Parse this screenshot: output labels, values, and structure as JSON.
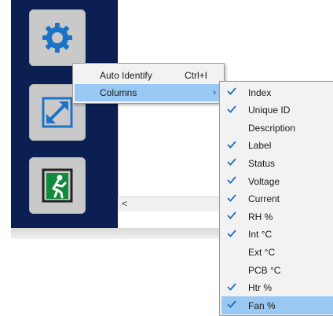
{
  "context_menu": {
    "items": [
      {
        "label": "Auto Identify",
        "shortcut": "Ctrl+I"
      },
      {
        "label": "Columns",
        "submenu_arrow": "›"
      }
    ]
  },
  "columns_submenu": {
    "items": [
      {
        "label": "Index",
        "checked": true
      },
      {
        "label": "Unique ID",
        "checked": true
      },
      {
        "label": "Description",
        "checked": false
      },
      {
        "label": "Label",
        "checked": true
      },
      {
        "label": "Status",
        "checked": true
      },
      {
        "label": "Voltage",
        "checked": true
      },
      {
        "label": "Current",
        "checked": true
      },
      {
        "label": "RH %",
        "checked": true
      },
      {
        "label": "Int °C",
        "checked": true
      },
      {
        "label": "Ext °C",
        "checked": false
      },
      {
        "label": "PCB °C",
        "checked": false
      },
      {
        "label": "Htr %",
        "checked": true
      },
      {
        "label": "Fan %",
        "checked": true
      }
    ],
    "highlighted_index": 12
  },
  "scrollbar": {
    "left_arrow": "<"
  },
  "colors": {
    "panel": "#0b1f52",
    "highlight": "#99c8f3",
    "check": "#1f6fbf",
    "icon_blue": "#1b73c8"
  },
  "icons": [
    "settings-gear-icon",
    "expand-arrows-icon",
    "exit-door-icon",
    "checkmark-icon",
    "submenu-arrow-icon"
  ]
}
